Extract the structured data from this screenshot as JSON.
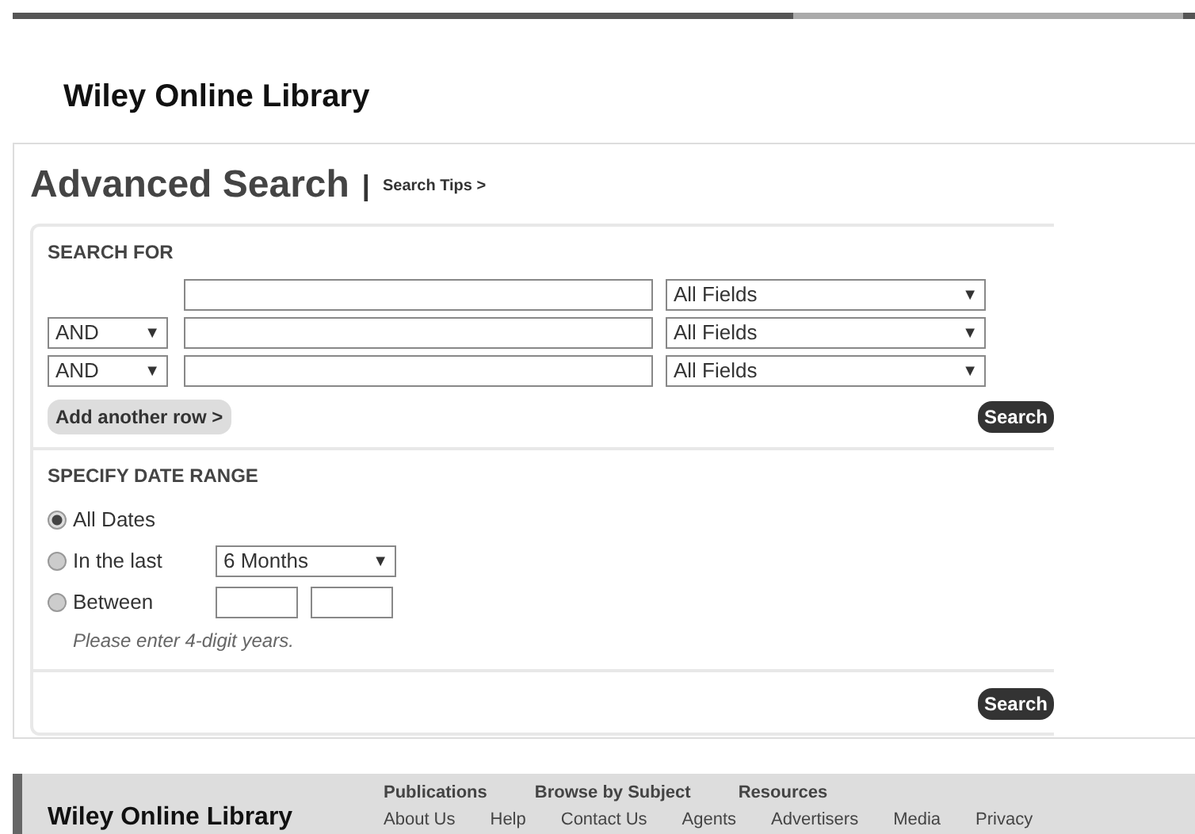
{
  "header": {
    "logo": "Wiley Online Library"
  },
  "page": {
    "title": "Advanced Search",
    "separator": "|",
    "tips_link": "Search Tips >"
  },
  "search_for": {
    "heading": "SEARCH FOR",
    "dropdown_arrow": "▼",
    "rows": [
      {
        "operator": null,
        "field": "All Fields"
      },
      {
        "operator": "AND",
        "field": "All Fields"
      },
      {
        "operator": "AND",
        "field": "All Fields"
      }
    ],
    "add_row": "Add another row >",
    "search_button": "Search"
  },
  "date_range": {
    "heading": "SPECIFY DATE RANGE",
    "dropdown_arrow": "▼",
    "options": [
      {
        "kind": "plain",
        "label": "All Dates",
        "selected": true
      },
      {
        "kind": "period",
        "label": "In the last",
        "value": "6 Months",
        "selected": false
      },
      {
        "kind": "years",
        "label": "Between",
        "selected": false
      }
    ],
    "hint": "Please enter 4-digit years."
  },
  "bottom_search_button": "Search",
  "footer": {
    "logo": "Wiley Online Library",
    "primary_links": [
      "Publications",
      "Browse by Subject",
      "Resources"
    ],
    "secondary_links": [
      "About Us",
      "Help",
      "Contact Us",
      "Agents",
      "Advertisers",
      "Media",
      "Privacy"
    ]
  }
}
